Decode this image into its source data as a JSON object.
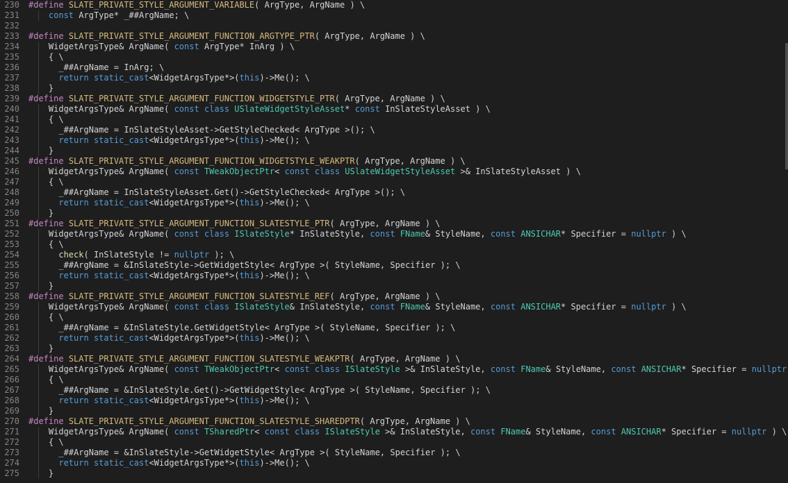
{
  "editor": {
    "lines": [
      {
        "n": "230",
        "text": "#define SLATE_PRIVATE_STYLE_ARGUMENT_VARIABLE( ArgType, ArgName ) \\"
      },
      {
        "n": "231",
        "text": "    const ArgType* _##ArgName; \\"
      },
      {
        "n": "232",
        "text": ""
      },
      {
        "n": "233",
        "text": "#define SLATE_PRIVATE_STYLE_ARGUMENT_FUNCTION_ARGTYPE_PTR( ArgType, ArgName ) \\"
      },
      {
        "n": "234",
        "text": "    WidgetArgsType& ArgName( const ArgType* InArg ) \\"
      },
      {
        "n": "235",
        "text": "    { \\"
      },
      {
        "n": "236",
        "text": "      _##ArgName = InArg; \\"
      },
      {
        "n": "237",
        "text": "      return static_cast<WidgetArgsType*>(this)->Me(); \\"
      },
      {
        "n": "238",
        "text": "    }"
      },
      {
        "n": "239",
        "text": "#define SLATE_PRIVATE_STYLE_ARGUMENT_FUNCTION_WIDGETSTYLE_PTR( ArgType, ArgName ) \\"
      },
      {
        "n": "240",
        "text": "    WidgetArgsType& ArgName( const class USlateWidgetStyleAsset* const InSlateStyleAsset ) \\"
      },
      {
        "n": "241",
        "text": "    { \\"
      },
      {
        "n": "242",
        "text": "      _##ArgName = InSlateStyleAsset->GetStyleChecked< ArgType >(); \\"
      },
      {
        "n": "243",
        "text": "      return static_cast<WidgetArgsType*>(this)->Me(); \\"
      },
      {
        "n": "244",
        "text": "    }"
      },
      {
        "n": "245",
        "text": "#define SLATE_PRIVATE_STYLE_ARGUMENT_FUNCTION_WIDGETSTYLE_WEAKPTR( ArgType, ArgName ) \\"
      },
      {
        "n": "246",
        "text": "    WidgetArgsType& ArgName( const TWeakObjectPtr< const class USlateWidgetStyleAsset >& InSlateStyleAsset ) \\"
      },
      {
        "n": "247",
        "text": "    { \\"
      },
      {
        "n": "248",
        "text": "      _##ArgName = InSlateStyleAsset.Get()->GetStyleChecked< ArgType >(); \\"
      },
      {
        "n": "249",
        "text": "      return static_cast<WidgetArgsType*>(this)->Me(); \\"
      },
      {
        "n": "250",
        "text": "    }"
      },
      {
        "n": "251",
        "text": "#define SLATE_PRIVATE_STYLE_ARGUMENT_FUNCTION_SLATESTYLE_PTR( ArgType, ArgName ) \\"
      },
      {
        "n": "252",
        "text": "    WidgetArgsType& ArgName( const class ISlateStyle* InSlateStyle, const FName& StyleName, const ANSICHAR* Specifier = nullptr ) \\"
      },
      {
        "n": "253",
        "text": "    { \\"
      },
      {
        "n": "254",
        "text": "      check( InSlateStyle != nullptr ); \\"
      },
      {
        "n": "255",
        "text": "      _##ArgName = &InSlateStyle->GetWidgetStyle< ArgType >( StyleName, Specifier ); \\"
      },
      {
        "n": "256",
        "text": "      return static_cast<WidgetArgsType*>(this)->Me(); \\"
      },
      {
        "n": "257",
        "text": "    }"
      },
      {
        "n": "258",
        "text": "#define SLATE_PRIVATE_STYLE_ARGUMENT_FUNCTION_SLATESTYLE_REF( ArgType, ArgName ) \\"
      },
      {
        "n": "259",
        "text": "    WidgetArgsType& ArgName( const class ISlateStyle& InSlateStyle, const FName& StyleName, const ANSICHAR* Specifier = nullptr ) \\"
      },
      {
        "n": "260",
        "text": "    { \\"
      },
      {
        "n": "261",
        "text": "      _##ArgName = &InSlateStyle.GetWidgetStyle< ArgType >( StyleName, Specifier ); \\"
      },
      {
        "n": "262",
        "text": "      return static_cast<WidgetArgsType*>(this)->Me(); \\"
      },
      {
        "n": "263",
        "text": "    }"
      },
      {
        "n": "264",
        "text": "#define SLATE_PRIVATE_STYLE_ARGUMENT_FUNCTION_SLATESTYLE_WEAKPTR( ArgType, ArgName ) \\"
      },
      {
        "n": "265",
        "text": "    WidgetArgsType& ArgName( const TWeakObjectPtr< const class ISlateStyle >& InSlateStyle, const FName& StyleName, const ANSICHAR* Specifier = nullptr ) \\"
      },
      {
        "n": "266",
        "text": "    { \\"
      },
      {
        "n": "267",
        "text": "      _##ArgName = &InSlateStyle.Get()->GetWidgetStyle< ArgType >( StyleName, Specifier ); \\"
      },
      {
        "n": "268",
        "text": "      return static_cast<WidgetArgsType*>(this)->Me(); \\"
      },
      {
        "n": "269",
        "text": "    }"
      },
      {
        "n": "270",
        "text": "#define SLATE_PRIVATE_STYLE_ARGUMENT_FUNCTION_SLATESTYLE_SHAREDPTR( ArgType, ArgName ) \\"
      },
      {
        "n": "271",
        "text": "    WidgetArgsType& ArgName( const TSharedPtr< const class ISlateStyle >& InSlateStyle, const FName& StyleName, const ANSICHAR* Specifier = nullptr ) \\"
      },
      {
        "n": "272",
        "text": "    { \\"
      },
      {
        "n": "273",
        "text": "      _##ArgName = &InSlateStyle->GetWidgetStyle< ArgType >( StyleName, Specifier ); \\"
      },
      {
        "n": "274",
        "text": "      return static_cast<WidgetArgsType*>(this)->Me(); \\"
      },
      {
        "n": "275",
        "text": "    }"
      }
    ],
    "colors": {
      "background": "#1e1e1e",
      "line_number": "#858585",
      "preprocessor": "#c586c0",
      "macro_name": "#d7ba7d",
      "keyword": "#569cd6",
      "type": "#4ec9b0",
      "function": "#dcdcaa",
      "identifier": "#d4d4d4"
    }
  }
}
